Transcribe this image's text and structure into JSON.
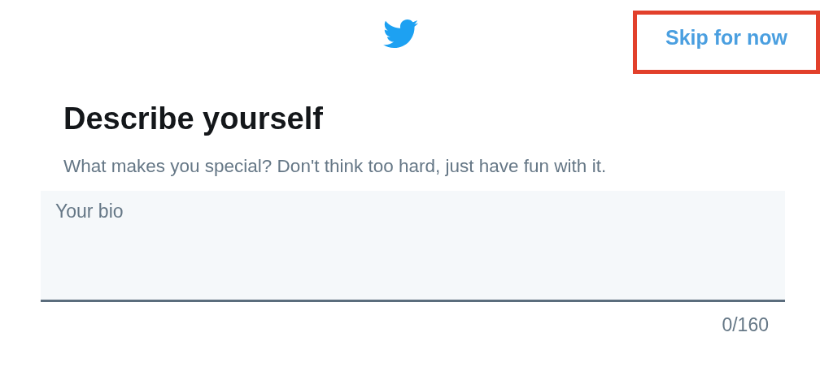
{
  "header": {
    "skip_link": {
      "label": "Skip for now",
      "highlighted": true
    }
  },
  "title": "Describe yourself",
  "subtitle": "What makes you special? Don't think too hard, just have fun with it.",
  "bio_field": {
    "placeholder": "Your bio"
  },
  "counter": "0/160"
}
